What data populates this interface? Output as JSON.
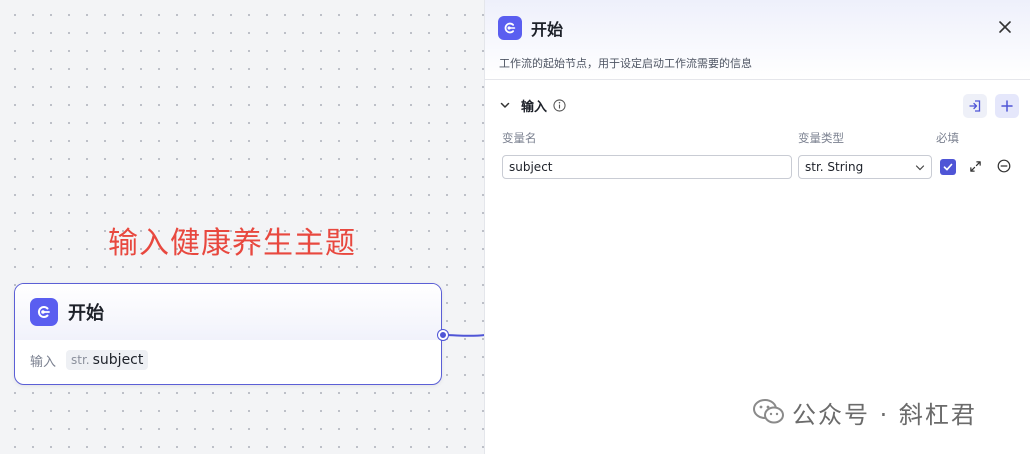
{
  "canvas": {
    "annotation": "输入健康养生主题"
  },
  "node": {
    "title": "开始",
    "input_label": "输入",
    "variable": {
      "type_prefix": "str.",
      "name": "subject"
    }
  },
  "panel": {
    "title": "开始",
    "description": "工作流的起始节点，用于设定启动工作流需要的信息",
    "section": {
      "label": "输入",
      "columns": {
        "name": "变量名",
        "type": "变量类型",
        "required": "必填"
      },
      "rows": [
        {
          "name": "subject",
          "type": "str. String",
          "required": true
        }
      ]
    }
  },
  "watermark": {
    "text": "公众号 · 斜杠君"
  },
  "colors": {
    "accent": "#5a5ef0",
    "annotation": "#e8483f",
    "node_border": "#5b5fd6"
  }
}
